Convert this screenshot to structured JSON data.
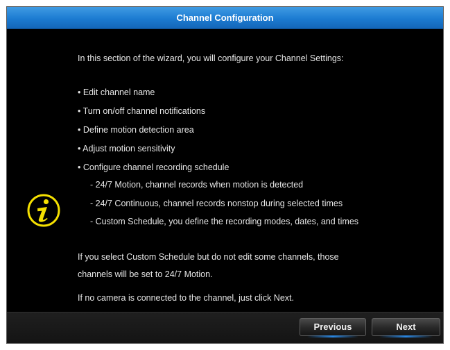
{
  "dialog": {
    "title": "Channel Configuration"
  },
  "content": {
    "intro": "In this section of the wizard, you will configure your Channel Settings:",
    "bullets": [
      "• Edit channel name",
      "• Turn on/off channel notifications",
      "• Define motion detection area",
      "• Adjust motion sensitivity",
      "• Configure channel recording schedule"
    ],
    "sub_bullets": [
      "- 24/7 Motion, channel records when motion is detected",
      "- 24/7 Continuous, channel records nonstop during selected times",
      "- Custom Schedule, you define the recording modes, dates, and times"
    ],
    "note_line1": "If you select Custom Schedule but do not edit some channels, those",
    "note_line2": "channels will be set to  24/7 Motion.",
    "note_line3": "If no camera is connected to the channel, just click Next."
  },
  "icons": {
    "info": "info-icon"
  },
  "footer": {
    "previous_label": "Previous",
    "next_label": "Next"
  },
  "colors": {
    "titlebar": "#1c7bd1",
    "icon": "#f5e000",
    "background": "#000000"
  }
}
